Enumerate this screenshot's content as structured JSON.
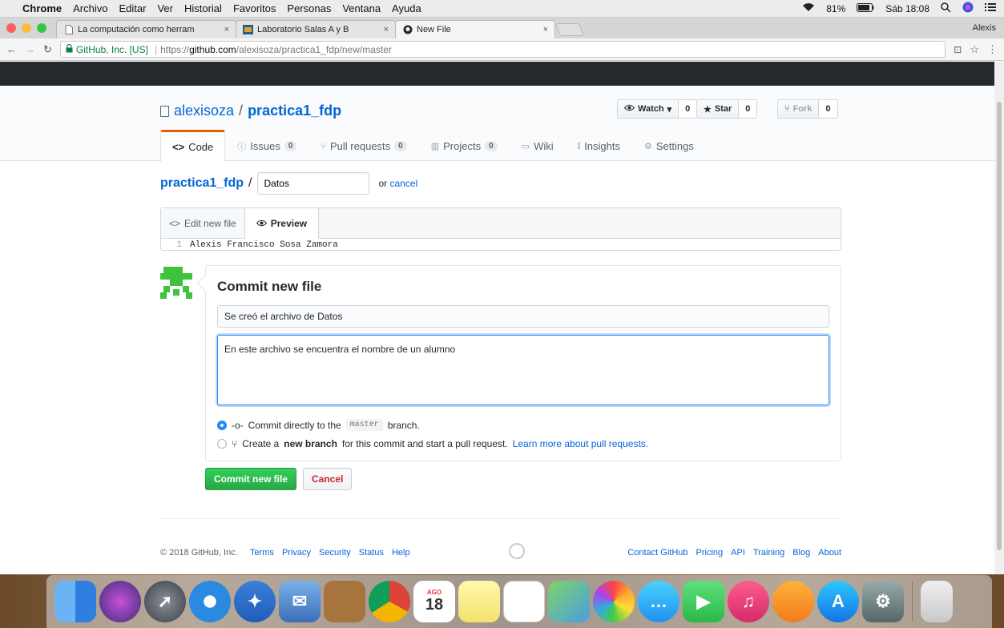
{
  "menubar": {
    "items": [
      "Chrome",
      "Archivo",
      "Editar",
      "Ver",
      "Historial",
      "Favoritos",
      "Personas",
      "Ventana",
      "Ayuda"
    ],
    "battery": "81%",
    "clock": "Sáb 18:08"
  },
  "browser": {
    "tabs": [
      {
        "title": "La computación como herram",
        "active": false
      },
      {
        "title": "Laboratorio Salas A y B",
        "active": false
      },
      {
        "title": "New File",
        "active": true
      }
    ],
    "profile": "Alexis",
    "secure_label": "GitHub, Inc. [US]",
    "url_scheme": "https://",
    "url_host": "github.com",
    "url_path": "/alexisoza/practica1_fdp/new/master"
  },
  "repo": {
    "owner": "alexisoza",
    "name": "practica1_fdp",
    "watch_label": "Watch",
    "watch_count": "0",
    "star_label": "Star",
    "star_count": "0",
    "fork_label": "Fork",
    "fork_count": "0"
  },
  "nav": {
    "code": "Code",
    "issues": "Issues",
    "issues_count": "0",
    "pulls": "Pull requests",
    "pulls_count": "0",
    "projects": "Projects",
    "projects_count": "0",
    "wiki": "Wiki",
    "insights": "Insights",
    "settings": "Settings"
  },
  "path": {
    "crumb": "practica1_fdp",
    "slash": "/",
    "filename": "Datos",
    "or_text": "or",
    "cancel_link": "cancel"
  },
  "editor": {
    "edit_tab": "Edit new file",
    "preview_tab": "Preview",
    "line_number": "1",
    "line_text": "Alexis Francisco Sosa Zamora"
  },
  "commit": {
    "heading": "Commit new file",
    "summary": "Se creó el archivo de Datos",
    "description": "En este archivo se encuentra el nombre de un alumno",
    "direct_prefix": "Commit directly to the",
    "branch": "master",
    "direct_suffix": "branch.",
    "new_prefix": "Create a",
    "new_bold": "new branch",
    "new_suffix": "for this commit and start a pull request.",
    "learn_more": "Learn more about pull requests.",
    "commit_button": "Commit new file",
    "cancel_button": "Cancel"
  },
  "footer": {
    "copyright": "© 2018 GitHub, Inc.",
    "left_links": [
      "Terms",
      "Privacy",
      "Security",
      "Status",
      "Help"
    ],
    "right_links": [
      "Contact GitHub",
      "Pricing",
      "API",
      "Training",
      "Blog",
      "About"
    ]
  },
  "dock": {
    "calendar_month": "AGO",
    "calendar_day": "18"
  },
  "colors": {
    "accent": "#0366d6",
    "commit_green": "#28a745",
    "cancel_red": "#cb2431",
    "nav_underline": "#e36209"
  }
}
